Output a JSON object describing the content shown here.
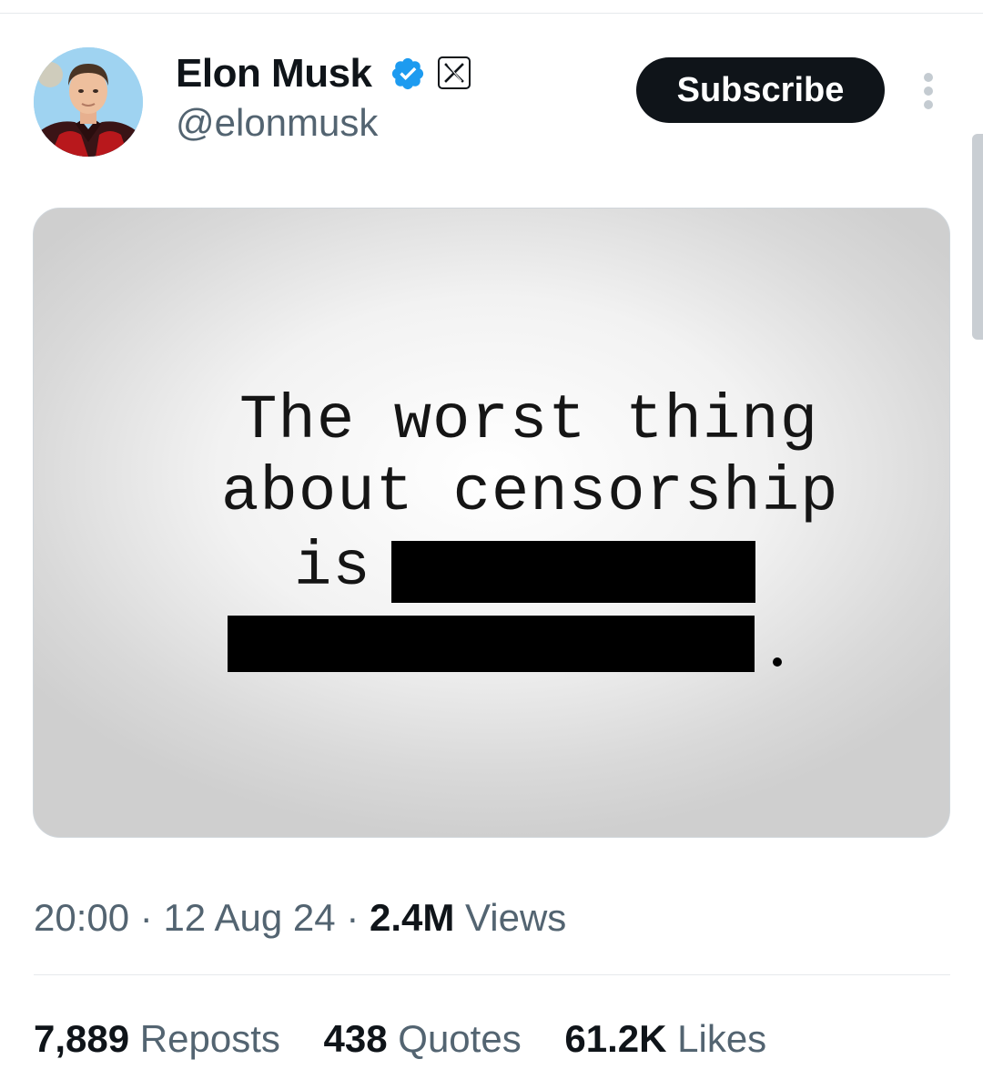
{
  "author": {
    "display_name": "Elon Musk",
    "handle": "@elonmusk",
    "verified_icon": "verified-badge-icon",
    "affiliation_icon": "x-logo-icon"
  },
  "actions": {
    "subscribe_label": "Subscribe",
    "more_icon": "more-vertical-icon"
  },
  "media": {
    "lines": [
      "The worst thing",
      "about censorship",
      "is"
    ],
    "trailing_punctuation": "."
  },
  "meta": {
    "time": "20:00",
    "separator": "·",
    "date": "12 Aug 24",
    "views_count": "2.4M",
    "views_label": "Views"
  },
  "stats": [
    {
      "count": "7,889",
      "label": "Reposts"
    },
    {
      "count": "438",
      "label": "Quotes"
    },
    {
      "count": "61.2K",
      "label": "Likes"
    }
  ],
  "colors": {
    "text_primary": "#0f1419",
    "text_secondary": "#536471",
    "verified_blue": "#1d9bf0",
    "button_bg": "#0f1419",
    "redaction": "#000000"
  }
}
